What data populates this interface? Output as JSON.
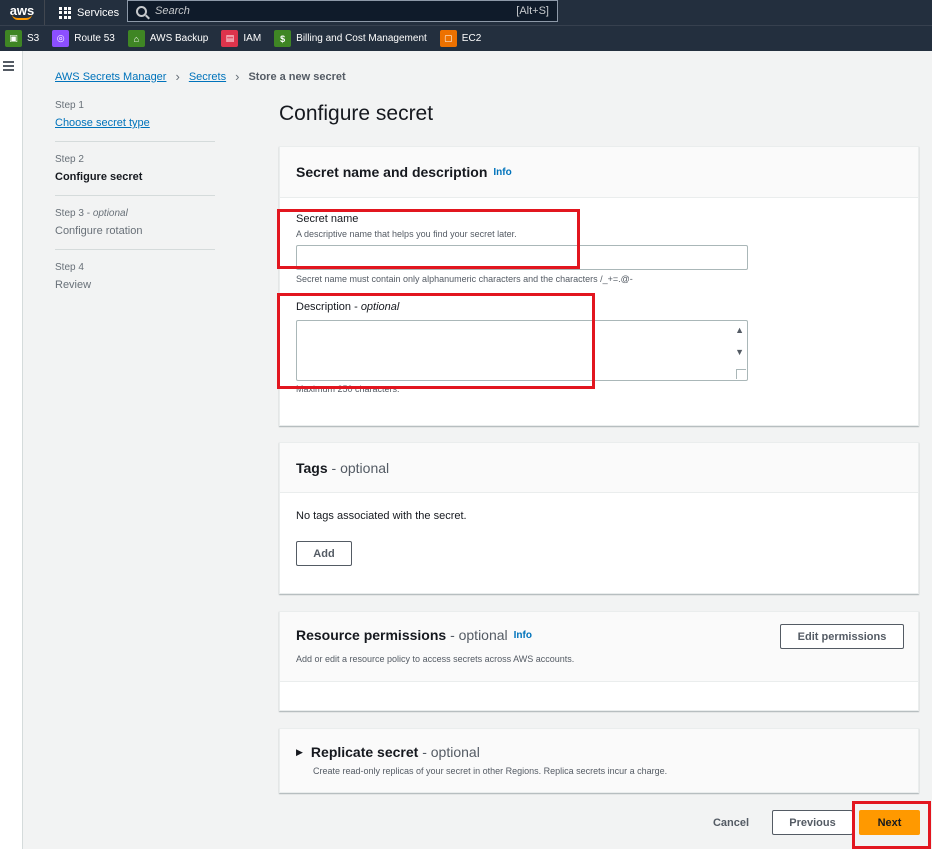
{
  "topnav": {
    "logo_text": "aws",
    "services_label": "Services",
    "search_placeholder": "Search",
    "search_shortcut": "[Alt+S]"
  },
  "favorites": [
    {
      "label": "S3",
      "icon": "s3-icon",
      "color": "#3f8624"
    },
    {
      "label": "Route 53",
      "icon": "route53-icon",
      "color": "#8c4fff"
    },
    {
      "label": "AWS Backup",
      "icon": "backup-icon",
      "color": "#3f8624"
    },
    {
      "label": "IAM",
      "icon": "iam-icon",
      "color": "#dd344c"
    },
    {
      "label": "Billing and Cost Management",
      "icon": "billing-icon",
      "color": "#3f8624"
    },
    {
      "label": "EC2",
      "icon": "ec2-icon",
      "color": "#ed7100"
    }
  ],
  "breadcrumb": {
    "items": [
      "AWS Secrets Manager",
      "Secrets"
    ],
    "current": "Store a new secret"
  },
  "steps": [
    {
      "num": "Step 1",
      "label": "Choose secret type"
    },
    {
      "num": "Step 2",
      "label": "Configure secret"
    },
    {
      "num": "Step 3",
      "num_suffix": "optional",
      "label": "Configure rotation"
    },
    {
      "num": "Step 4",
      "label": "Review"
    }
  ],
  "page_title": "Configure secret",
  "secret_panel": {
    "title": "Secret name and description",
    "info": "Info",
    "name_label": "Secret name",
    "name_desc": "A descriptive name that helps you find your secret later.",
    "name_value": "",
    "name_hint": "Secret name must contain only alphanumeric characters and the characters /_+=.@-",
    "description_label": "Description",
    "description_optional": "optional",
    "description_value": "",
    "description_hint": "Maximum 250 characters."
  },
  "tags_panel": {
    "title": "Tags",
    "optional": "- optional",
    "empty_text": "No tags associated with the secret.",
    "add_label": "Add"
  },
  "permissions_panel": {
    "title": "Resource permissions",
    "optional": "- optional",
    "info": "Info",
    "desc": "Add or edit a resource policy to access secrets across AWS accounts.",
    "edit_label": "Edit permissions"
  },
  "replicate_panel": {
    "title": "Replicate secret",
    "optional": "- optional",
    "desc": "Create read-only replicas of your secret in other Regions. Replica secrets incur a charge."
  },
  "footer": {
    "cancel_label": "Cancel",
    "previous_label": "Previous",
    "next_label": "Next"
  },
  "colors": {
    "accent": "#ff9900",
    "link": "#0073bb",
    "highlight": "#e2161f"
  }
}
